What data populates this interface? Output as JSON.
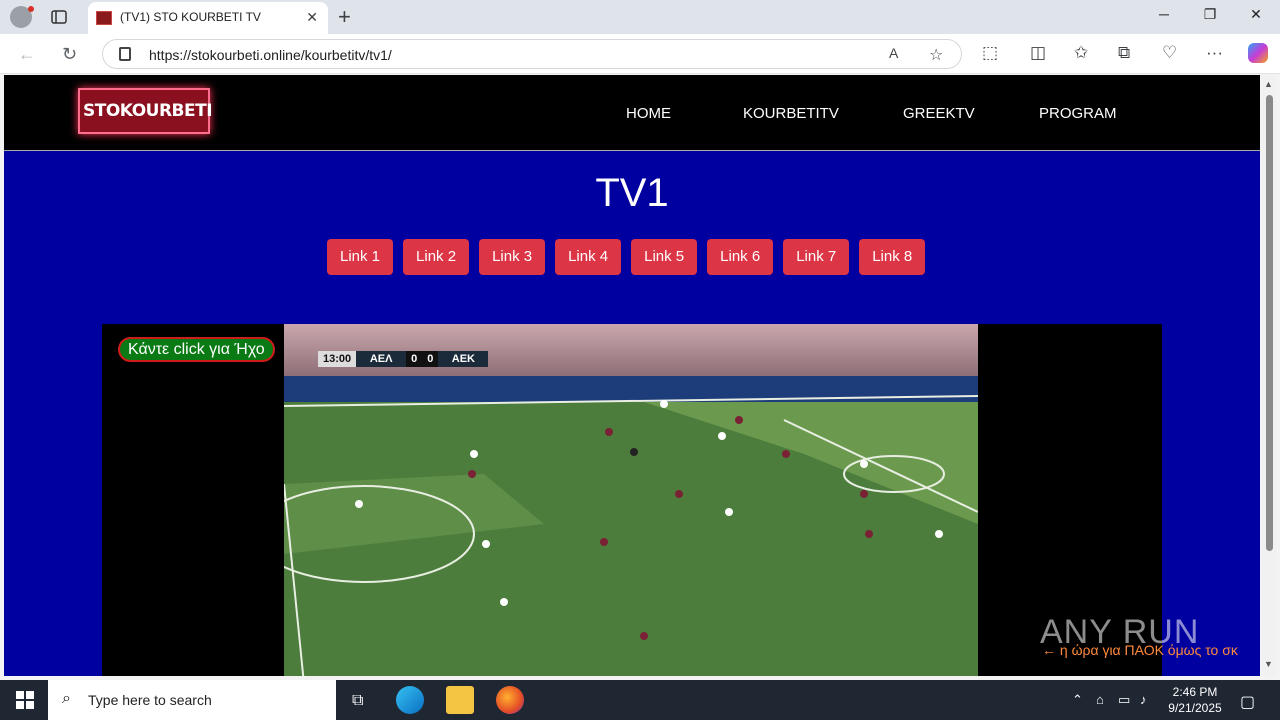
{
  "browser": {
    "tab_title": "(TV1) STO KOURBETI TV",
    "url": "https://stokourbeti.online/kourbetitv/tv1/"
  },
  "site": {
    "logo_text": "STOKOURBETI",
    "nav": [
      "HOME",
      "KOURBETITV",
      "GREEKTV",
      "PROGRAM"
    ],
    "page_title": "TV1",
    "links": [
      "Link 1",
      "Link 2",
      "Link 3",
      "Link 4",
      "Link 5",
      "Link 6",
      "Link 7",
      "Link 8"
    ],
    "sound_button": "Κάντε click για Ήχο",
    "ticker": "← η ώρα για ΠΑΟΚ όμως το σκ"
  },
  "scoreboard": {
    "time": "13:00",
    "home_team": "ΑΕΛ",
    "home_score": "0",
    "away_score": "0",
    "away_team": "ΑΕΚ"
  },
  "watermark": "ANY RUN",
  "taskbar": {
    "search_placeholder": "Type here to search",
    "time": "2:46 PM",
    "date": "9/21/2025"
  },
  "colors": {
    "page_background": "#0000a0",
    "link_button": "#dc3545",
    "header": "#000000"
  }
}
